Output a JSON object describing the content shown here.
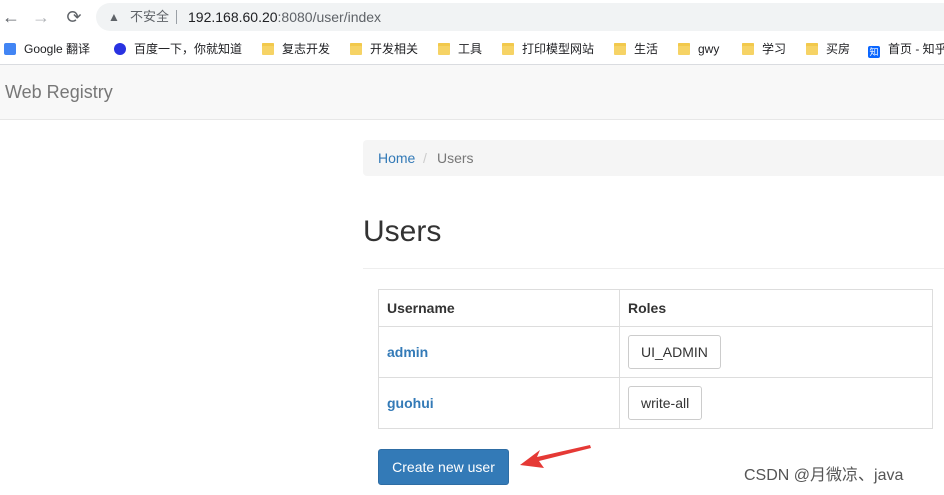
{
  "browser": {
    "back_icon": "←",
    "forward_icon": "→",
    "reload_icon": "⟳",
    "warn_icon": "▲",
    "insecure_label": "不安全",
    "url_host": "192.168.60.20",
    "url_rest": ":8080/user/index"
  },
  "bookmarks": [
    {
      "label": "Google 翻译",
      "icon": "google-translate-icon"
    },
    {
      "label": "百度一下，你就知道",
      "icon": "baidu-paw-icon"
    },
    {
      "label": "复志开发",
      "icon": "folder-icon"
    },
    {
      "label": "开发相关",
      "icon": "folder-icon"
    },
    {
      "label": "工具",
      "icon": "folder-icon"
    },
    {
      "label": "打印模型网站",
      "icon": "folder-icon"
    },
    {
      "label": "生活",
      "icon": "folder-icon"
    },
    {
      "label": "gwy",
      "icon": "folder-icon"
    },
    {
      "label": "学习",
      "icon": "folder-icon"
    },
    {
      "label": "买房",
      "icon": "folder-icon"
    },
    {
      "label": "首页 - 知乎",
      "icon": "zhihu-icon",
      "icon_text": "知"
    }
  ],
  "navbar": {
    "brand": "Web Registry"
  },
  "breadcrumb": {
    "home": "Home",
    "separator": "/",
    "current": "Users"
  },
  "page": {
    "title": "Users"
  },
  "table": {
    "headers": [
      "Username",
      "Roles"
    ],
    "rows": [
      {
        "username": "admin",
        "role": "UI_ADMIN"
      },
      {
        "username": "guohui",
        "role": "write-all"
      }
    ]
  },
  "create_button": "Create new user",
  "watermark": "CSDN @月微凉、java",
  "colors": {
    "link": "#337ab7",
    "primary": "#337ab7",
    "annotation_arrow": "#e53935"
  }
}
